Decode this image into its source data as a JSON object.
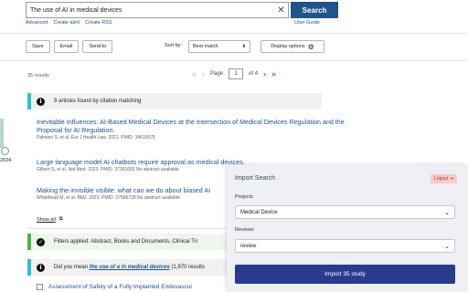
{
  "search": {
    "query": "The use of AI in medical devices",
    "clear_icon": "close-icon",
    "button_label": "Search",
    "links": [
      "Advanced",
      "Create alert",
      "Create RSS"
    ],
    "user_guide": "User Guide"
  },
  "toolbar": {
    "save": "Save",
    "email": "Email",
    "send_to": "Send to",
    "sort_label": "Sort by:",
    "sort_value": "Best match",
    "display_options": "Display options"
  },
  "results": {
    "count": "35 results",
    "page_label": "Page",
    "page_value": "1",
    "page_total": "of 4"
  },
  "timeline": {
    "year": "2024"
  },
  "citation_box": {
    "text": "9 articles found by citation matching"
  },
  "articles": [
    {
      "title": "Inevitable Influences: AI-Based Medical Devices at the Intersection of Medical Devices Regulation and the Proposal for AI Regulation.",
      "authors": "Palmieri S, et al.",
      "journal": "Eur J Health Law. 2021.",
      "pmid": "PMID: 34610575"
    },
    {
      "title": "Large language model AI chatbots require approval as medical devices.",
      "authors": "Gilbert S, et al.",
      "journal": "Nat Med. 2023.",
      "pmid": "PMID: 37391665 No abstract available."
    },
    {
      "title": "Making the invisible visible: what can we do about biased AI",
      "authors": "Whitehead M, et al.",
      "journal": "BMJ. 2023.",
      "pmid": "PMID: 37586728 No abstract available."
    }
  ],
  "show_all": "Show all",
  "filters_box": {
    "text": "Filters applied: Abstract, Books and Documents, Clinical Tri"
  },
  "did_you_mean": {
    "prefix": "Did you mean",
    "suggestion": "the use of a in medical devices",
    "suffix": "(1,970 results"
  },
  "last_article": {
    "title": "Assessment of Safety of a Fully Implanted Endovascul"
  },
  "import_panel": {
    "title": "Import Search",
    "logout": "Logout",
    "projects_label": "Projects",
    "project_value": "Medical Device",
    "reviews_label": "Reviews",
    "review_value": "review",
    "import_button": "Import 35 study"
  },
  "colors": {
    "primary": "#20558a",
    "info_accent": "#2dbfd9",
    "success_accent": "#4caf50",
    "import_button": "#2a3a8c",
    "logout_bg": "#f6c9cc"
  }
}
